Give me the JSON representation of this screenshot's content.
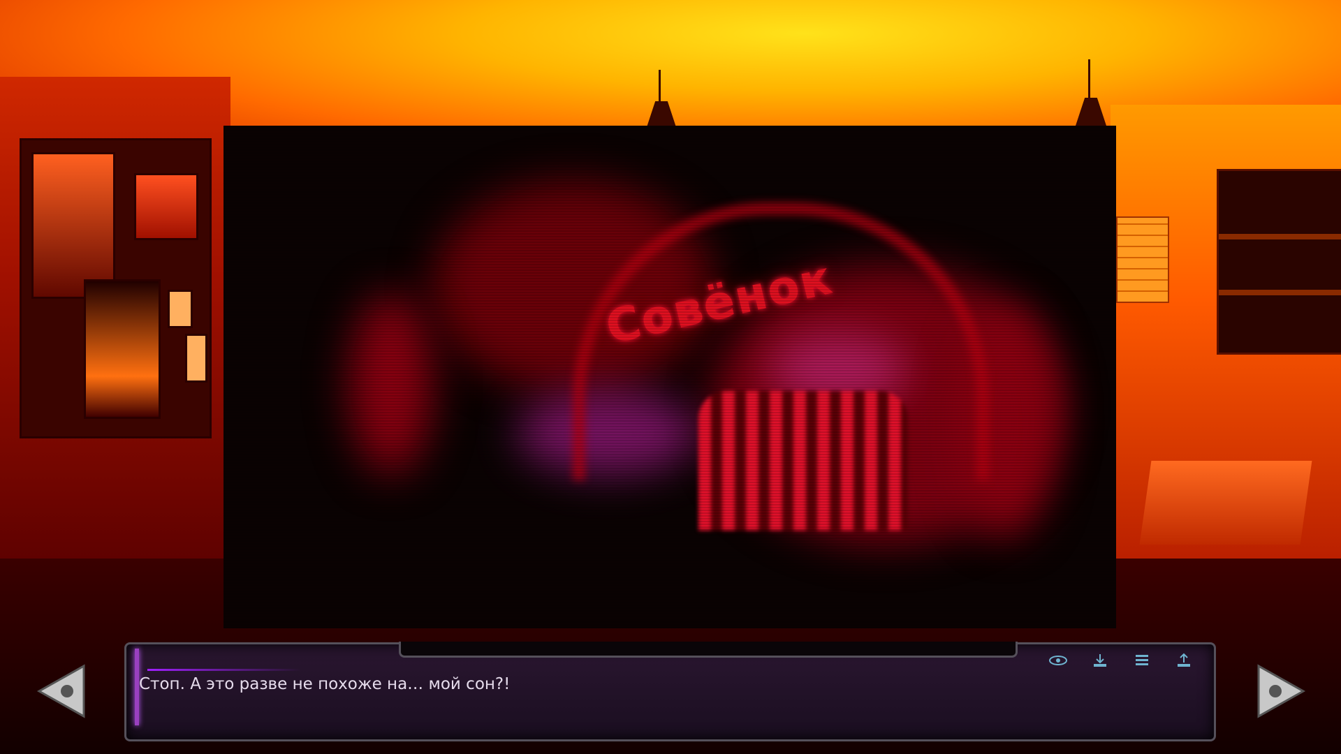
{
  "scene": {
    "sign_text": "Совёнок",
    "accent_color": "#ff2a00"
  },
  "dialogue": {
    "text": "Стоп. А это разве не похоже на… мой сон?!",
    "accent_color": "#9a40c0"
  },
  "controls": {
    "icons": [
      "eye-icon",
      "save-icon",
      "history-icon",
      "load-icon"
    ],
    "prev_icon": "arrow-left-icon",
    "next_icon": "arrow-right-icon",
    "icon_color": "#6fb4d0"
  }
}
